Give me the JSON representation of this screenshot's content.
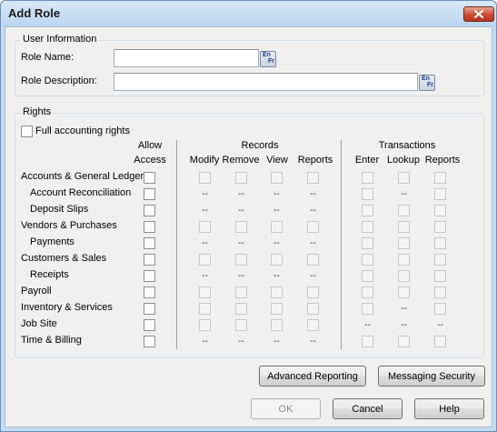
{
  "window": {
    "title": "Add Role"
  },
  "user_info": {
    "legend": "User Information",
    "role_name_label": "Role Name:",
    "role_name_value": "",
    "role_desc_label": "Role Description:",
    "role_desc_value": "",
    "lang_en": "En",
    "lang_fr": "Fr"
  },
  "rights": {
    "legend": "Rights",
    "full_rights_label": "Full accounting rights",
    "headers": {
      "allow": "Allow",
      "access": "Access",
      "records": "Records",
      "modify": "Modify",
      "remove": "Remove",
      "view": "View",
      "records_reports": "Reports",
      "transactions": "Transactions",
      "enter": "Enter",
      "lookup": "Lookup",
      "transactions_reports": "Reports"
    },
    "dash": "--",
    "rows": [
      {
        "label": "Accounts & General Ledger",
        "indent": false,
        "records": "cb",
        "trans": [
          "cb",
          "cb",
          "cb"
        ]
      },
      {
        "label": "Account Reconciliation",
        "indent": true,
        "records": "dash",
        "trans": [
          "cb",
          "dash",
          "cb"
        ]
      },
      {
        "label": "Deposit Slips",
        "indent": true,
        "records": "dash",
        "trans": [
          "cb",
          "cb",
          "cb"
        ]
      },
      {
        "label": "Vendors & Purchases",
        "indent": false,
        "records": "cb",
        "trans": [
          "cb",
          "cb",
          "cb"
        ]
      },
      {
        "label": "Payments",
        "indent": true,
        "records": "dash",
        "trans": [
          "cb",
          "cb",
          "cb"
        ]
      },
      {
        "label": "Customers & Sales",
        "indent": false,
        "records": "cb",
        "trans": [
          "cb",
          "cb",
          "cb"
        ]
      },
      {
        "label": "Receipts",
        "indent": true,
        "records": "dash",
        "trans": [
          "cb",
          "cb",
          "cb"
        ]
      },
      {
        "label": "Payroll",
        "indent": false,
        "records": "cb",
        "trans": [
          "cb",
          "cb",
          "cb"
        ]
      },
      {
        "label": "Inventory & Services",
        "indent": false,
        "records": "cb",
        "trans": [
          "cb",
          "dash",
          "cb"
        ]
      },
      {
        "label": "Job Site",
        "indent": false,
        "records": "cb",
        "trans": [
          "dash",
          "dash",
          "dash"
        ]
      },
      {
        "label": "Time & Billing",
        "indent": false,
        "records": "dash",
        "trans": [
          "cb",
          "cb",
          "cb"
        ]
      }
    ]
  },
  "buttons": {
    "advanced_reporting": "Advanced Reporting",
    "messaging_security": "Messaging Security",
    "ok": "OK",
    "cancel": "Cancel",
    "help": "Help"
  }
}
